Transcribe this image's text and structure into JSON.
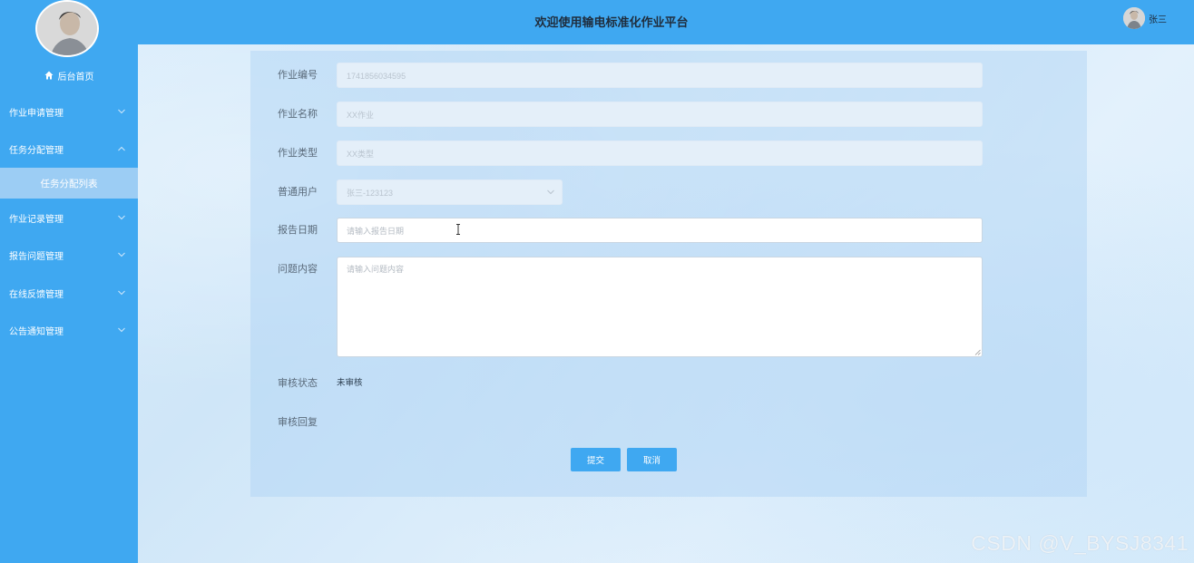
{
  "header": {
    "title": "欢迎使用输电标准化作业平台",
    "user_name": "张三"
  },
  "sidebar": {
    "home_label": "后台首页",
    "menu": [
      {
        "label": "作业申请管理",
        "icon": "chevron-down-icon"
      },
      {
        "label": "任务分配管理",
        "icon": "chevron-up-icon"
      },
      {
        "label": "作业记录管理",
        "icon": "chevron-down-icon"
      },
      {
        "label": "报告问题管理",
        "icon": "chevron-down-icon"
      },
      {
        "label": "在线反馈管理",
        "icon": "chevron-down-icon"
      },
      {
        "label": "公告通知管理",
        "icon": "chevron-down-icon"
      }
    ],
    "active_submenu_label": "任务分配列表"
  },
  "form": {
    "job_number": {
      "label": "作业编号",
      "value": "1741856034595"
    },
    "job_name": {
      "label": "作业名称",
      "value": "XX作业"
    },
    "job_type": {
      "label": "作业类型",
      "value": "XX类型"
    },
    "user": {
      "label": "普通用户",
      "value": "张三-123123"
    },
    "report_date": {
      "label": "报告日期",
      "placeholder": "请输入报告日期"
    },
    "issue_content": {
      "label": "问题内容",
      "placeholder": "请输入问题内容"
    },
    "review_status": {
      "label": "审核状态",
      "value": "未审核"
    },
    "review_reply": {
      "label": "审核回复"
    },
    "submit_label": "提交",
    "cancel_label": "取消"
  },
  "watermark": "CSDN @V_BYSJ8341",
  "colors": {
    "primary": "#3fa8f1",
    "submenu_active": "#9ccdf4",
    "panel": "#add3f4"
  }
}
